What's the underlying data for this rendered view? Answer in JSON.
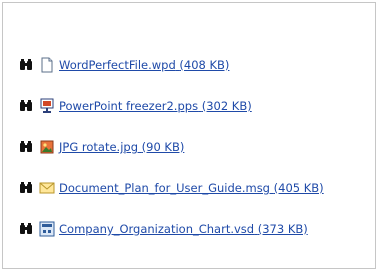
{
  "files": [
    {
      "name": "WordPerfectFile.wpd",
      "size": "(408 KB)",
      "icon": "generic-document-icon"
    },
    {
      "name": "PowerPoint freezer2.pps",
      "size": "(302 KB)",
      "icon": "powerpoint-slideshow-icon"
    },
    {
      "name": "JPG rotate.jpg",
      "size": "(90 KB)",
      "icon": "image-file-icon"
    },
    {
      "name": "Document_Plan_for_User_Guide.msg",
      "size": "(405 KB)",
      "icon": "email-message-icon"
    },
    {
      "name": "Company_Organization_Chart.vsd",
      "size": "(373 KB)",
      "icon": "visio-diagram-icon"
    }
  ],
  "preview_icon": "binoculars-icon",
  "colors": {
    "link": "#1f4aa8",
    "border": "#c6c6c6"
  }
}
